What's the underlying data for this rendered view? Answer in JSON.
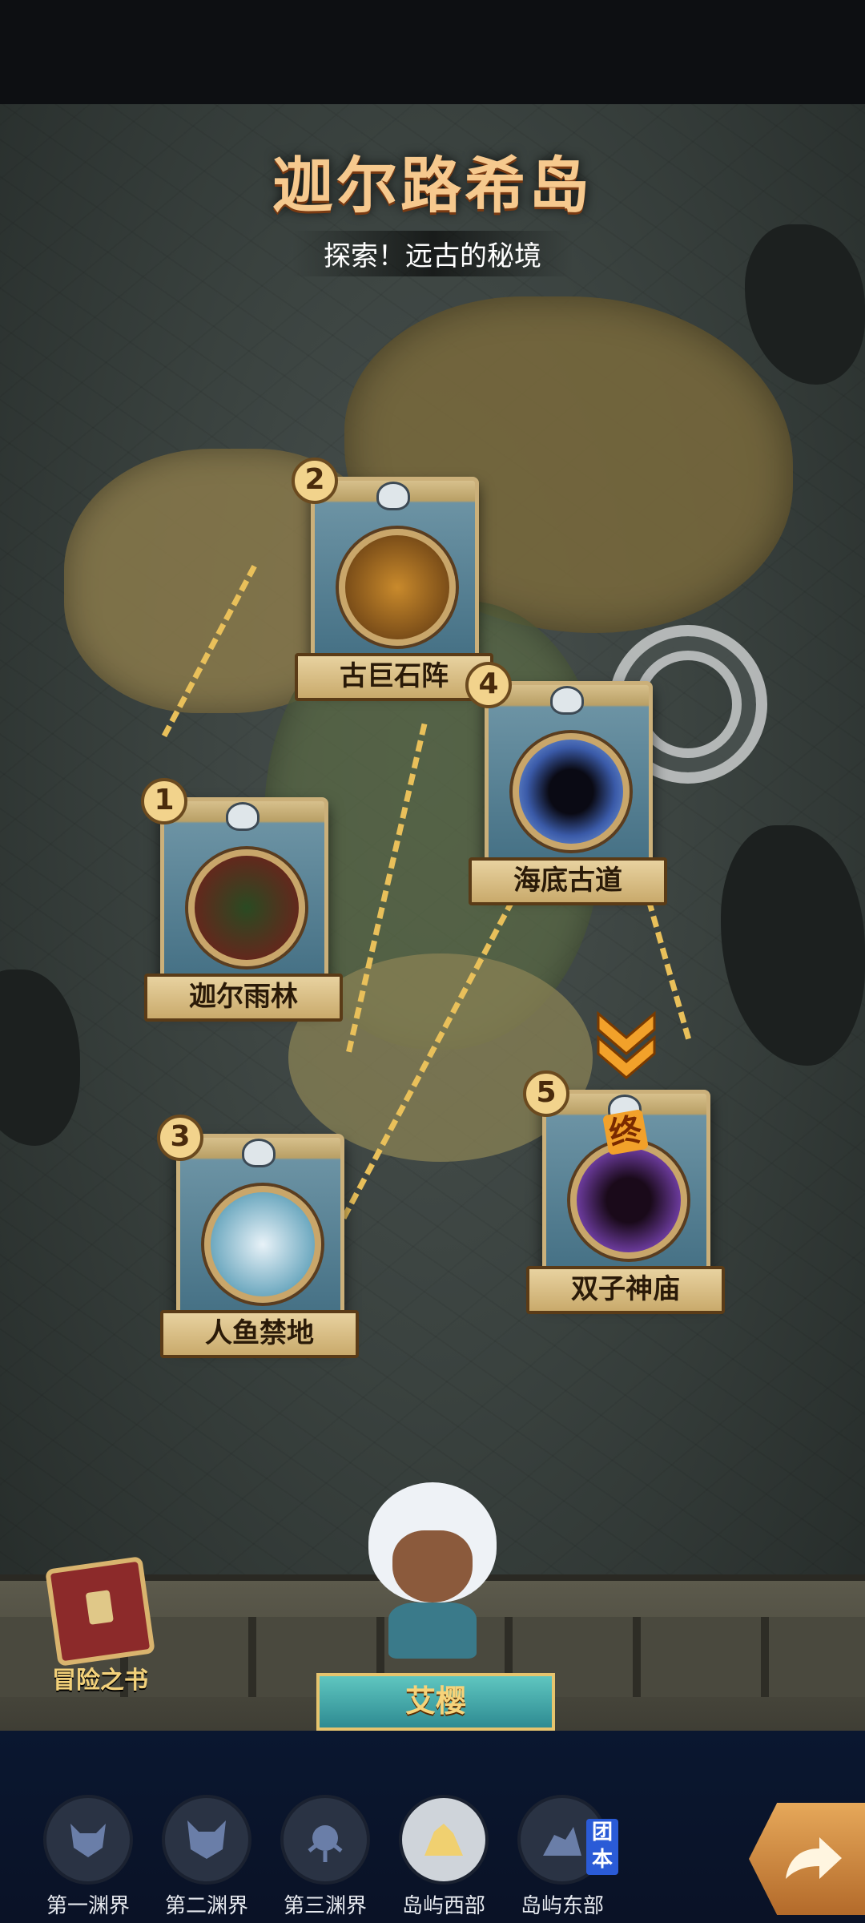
{
  "header": {
    "title": "迦尔路希岛",
    "subtitle": "探索！远古的秘境"
  },
  "stages": [
    {
      "number": "1",
      "name": "迦尔雨林"
    },
    {
      "number": "2",
      "name": "古巨石阵"
    },
    {
      "number": "3",
      "name": "人鱼禁地"
    },
    {
      "number": "4",
      "name": "海底古道"
    },
    {
      "number": "5",
      "name": "双子神庙",
      "end_mark": "终"
    }
  ],
  "book": {
    "label": "冒险之书"
  },
  "hero": {
    "name": "艾樱"
  },
  "nav": {
    "items": [
      {
        "label": "第一渊界",
        "icon": "demon-mask-icon"
      },
      {
        "label": "第二渊界",
        "icon": "horned-mask-icon"
      },
      {
        "label": "第三渊界",
        "icon": "tentacle-mask-icon"
      },
      {
        "label": "岛屿西部",
        "icon": "west-island-icon",
        "active": true
      },
      {
        "label": "岛屿东部",
        "icon": "east-island-icon"
      }
    ],
    "team_tag": "团本"
  },
  "colors": {
    "title": "#f6c98e",
    "path": "#e9c05a",
    "nav_bg": "#0a1730",
    "team_tag": "#2a5bd7"
  }
}
